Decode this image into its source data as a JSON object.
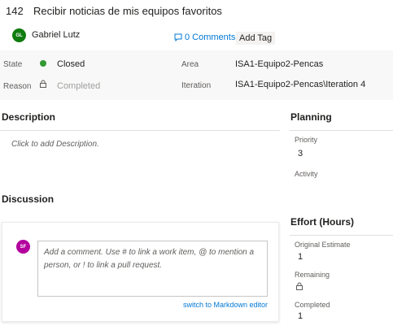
{
  "work_item": {
    "id": "142",
    "title": "Recibir noticias de mis equipos favoritos",
    "assignee": {
      "initials": "GL",
      "name": "Gabriel Lutz",
      "avatar_color": "#107c10"
    },
    "comments_link": "0 Comments",
    "add_tag": "Add Tag"
  },
  "fields": {
    "state_label": "State",
    "state_value": "Closed",
    "state_color": "#339933",
    "reason_label": "Reason",
    "reason_value": "Completed",
    "area_label": "Area",
    "area_value": "ISA1-Equipo2-Pencas",
    "iteration_label": "Iteration",
    "iteration_value": "ISA1-Equipo2-Pencas\\Iteration 4"
  },
  "description": {
    "title": "Description",
    "placeholder": "Click to add Description."
  },
  "discussion": {
    "title": "Discussion",
    "user_initials": "SF",
    "avatar_color": "#b4009e",
    "comment_placeholder": "Add a comment. Use # to link a work item, @ to mention a person, or ! to link a pull request.",
    "markdown_link": "switch to Markdown editor"
  },
  "planning": {
    "title": "Planning",
    "priority_label": "Priority",
    "priority_value": "3",
    "activity_label": "Activity"
  },
  "effort": {
    "title": "Effort (Hours)",
    "original_estimate_label": "Original Estimate",
    "original_estimate_value": "1",
    "remaining_label": "Remaining",
    "completed_label": "Completed",
    "completed_value": "1"
  }
}
